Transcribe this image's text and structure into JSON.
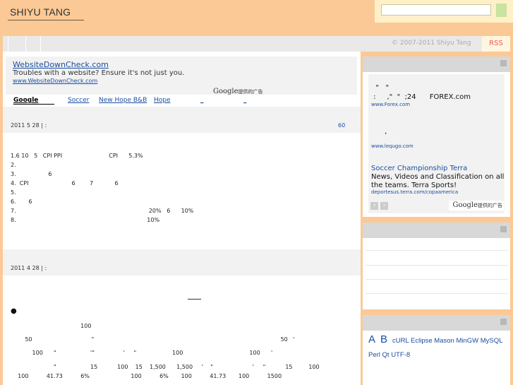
{
  "header": {
    "site_title": "SHIYU TANG",
    "search_placeholder": ""
  },
  "nav": {
    "copyright": "© 2007-2011 Shiyu Tang",
    "rss": "RSS"
  },
  "ad_top": {
    "title": "WebsiteDownCheck.com",
    "text": "Troubles with a website? Ensure it's not just you.",
    "url": "www.WebsiteDownCheck.com",
    "brand": "Google",
    "brand_suffix": "提供的广告"
  },
  "links_bar": {
    "google": "Google",
    "items": [
      "Soccer",
      "New Hope B&B",
      "Hope",
      "_",
      "_"
    ]
  },
  "posts": [
    {
      "date": "2011 5 28  |   :",
      "count": "60",
      "lines": [
        "1.6 10   5   CPI PPI                          CPI      5.3%",
        "2.",
        "3.                  6",
        "4.  CPI                        6        7            6",
        "5.",
        "6.       6",
        "7.                                                                          20%   6      10%",
        "8.                                                                         10%"
      ]
    },
    {
      "date": "2011 4 28  |   :",
      "count": "",
      "lines": [
        "                                       100",
        "        50                                 \"                                                                                                        50   '",
        "            100      \"                   '\"                '     \"                    100                                     100      '",
        "                        \"                   15           100    15    1,500      1,500     '    \"                      '     \"           15         100",
        "    100          41.73          6%                       100          6%       100          41.73       100          1500"
      ]
    }
  ],
  "sidebar_ad": {
    "line1": "  \"   \"",
    "line2": " :     ,\"  \"  ;24      FOREX.com",
    "url1": "www.Forex.com",
    "line3": "      ,",
    "url2": "www.lequgo.com",
    "title3": "Soccer Championship Terra",
    "text3a": "News, Videos and Classification on all",
    "text3b": "the teams. Terra Sports!",
    "url3": "deportesus.terra.com/copaamerica",
    "brand": "Google",
    "brand_suffix": "提供的广告"
  },
  "tags": {
    "big": [
      "A",
      "B"
    ],
    "row1": "cURL Eclipse Mason MinGW MySQL",
    "row2": "Perl Qt UTF-8"
  }
}
